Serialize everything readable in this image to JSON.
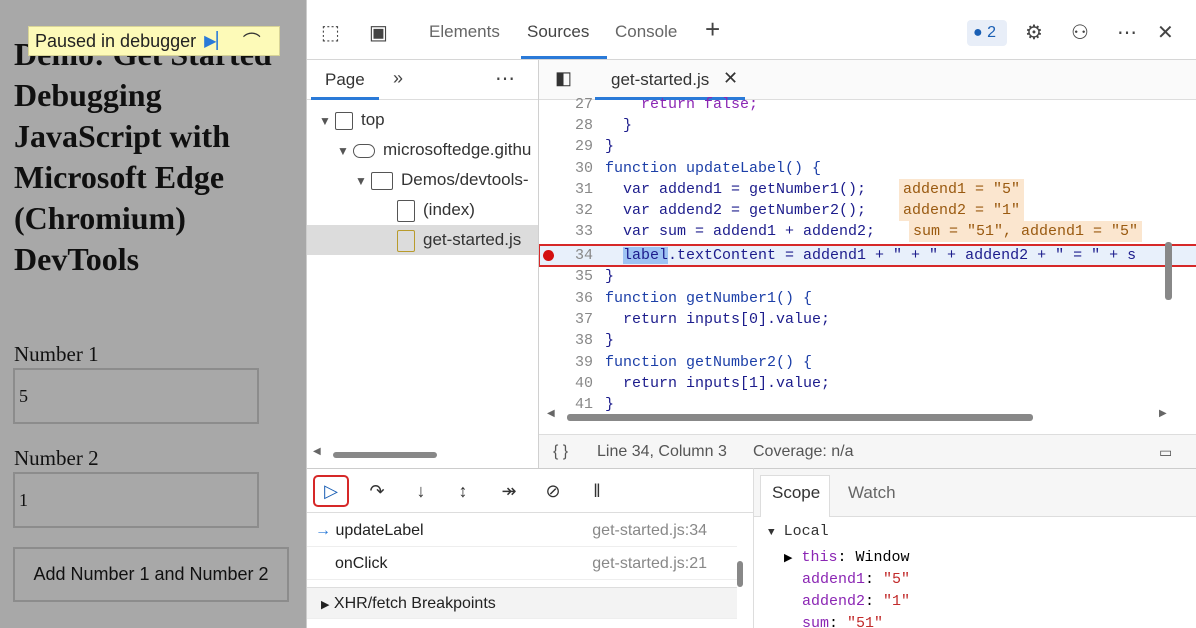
{
  "demo_page": {
    "title": "Demo: Get Started Debugging JavaScript with Microsoft Edge (Chromium) DevTools",
    "paused_banner": "Paused in debugger",
    "number1_label": "Number 1",
    "number1_value": "5",
    "number2_label": "Number 2",
    "number2_value": "1",
    "add_button": "Add Number 1 and Number 2"
  },
  "devtools": {
    "tabs": [
      "Elements",
      "Sources",
      "Console"
    ],
    "active_tab": "Sources",
    "issues_count": "2",
    "navigator": {
      "tab": "Page",
      "tree": [
        {
          "label": "top",
          "indent": 0,
          "expanded": true,
          "icon": "frame-icon"
        },
        {
          "label": "microsoftedge.githu",
          "indent": 1,
          "expanded": true,
          "icon": "cloud-icon"
        },
        {
          "label": "Demos/devtools-",
          "indent": 2,
          "expanded": true,
          "icon": "folder-icon"
        },
        {
          "label": "(index)",
          "indent": 3,
          "icon": "file-icon"
        },
        {
          "label": "get-started.js",
          "indent": 3,
          "icon": "js-file-icon",
          "selected": true
        }
      ]
    },
    "editor": {
      "file_tab": "get-started.js",
      "lines": [
        {
          "n": "27",
          "text": "    return false;"
        },
        {
          "n": "28",
          "text": "  }"
        },
        {
          "n": "29",
          "text": "}"
        },
        {
          "n": "30",
          "text": "function updateLabel() {"
        },
        {
          "n": "31",
          "text": "  var addend1 = getNumber1();",
          "inline": "addend1 = \"5\""
        },
        {
          "n": "32",
          "text": "  var addend2 = getNumber2();",
          "inline": "addend2 = \"1\""
        },
        {
          "n": "33",
          "text": "  var sum = addend1 + addend2;",
          "inline": "sum = \"51\", addend1 = \"5\""
        },
        {
          "n": "34",
          "text": "label.textContent = addend1 + \" + \" + addend2 + \" = \" + s",
          "breakpoint": true
        },
        {
          "n": "35",
          "text": "}"
        },
        {
          "n": "36",
          "text": "function getNumber1() {"
        },
        {
          "n": "37",
          "text": "  return inputs[0].value;"
        },
        {
          "n": "38",
          "text": "}"
        },
        {
          "n": "39",
          "text": "function getNumber2() {"
        },
        {
          "n": "40",
          "text": "  return inputs[1].value;"
        },
        {
          "n": "41",
          "text": "}"
        }
      ],
      "status": {
        "braces": "{ }",
        "position": "Line 34, Column 3",
        "coverage": "Coverage: n/a"
      }
    },
    "call_stack": [
      {
        "fn": "updateLabel",
        "loc": "get-started.js:34",
        "current": true
      },
      {
        "fn": "onClick",
        "loc": "get-started.js:21"
      }
    ],
    "xhr_section": "XHR/fetch Breakpoints",
    "scope": {
      "tabs": [
        "Scope",
        "Watch"
      ],
      "active": "Scope",
      "section": "Local",
      "entries": [
        {
          "key": "this",
          "value": "Window"
        },
        {
          "key": "addend1",
          "value": "\"5\""
        },
        {
          "key": "addend2",
          "value": "\"1\""
        },
        {
          "key": "sum",
          "value": "\"51\""
        }
      ]
    },
    "colors": {
      "accent": "#2a7ad8",
      "breakpoint": "#d41010",
      "highlight_box": "#d62828"
    }
  }
}
